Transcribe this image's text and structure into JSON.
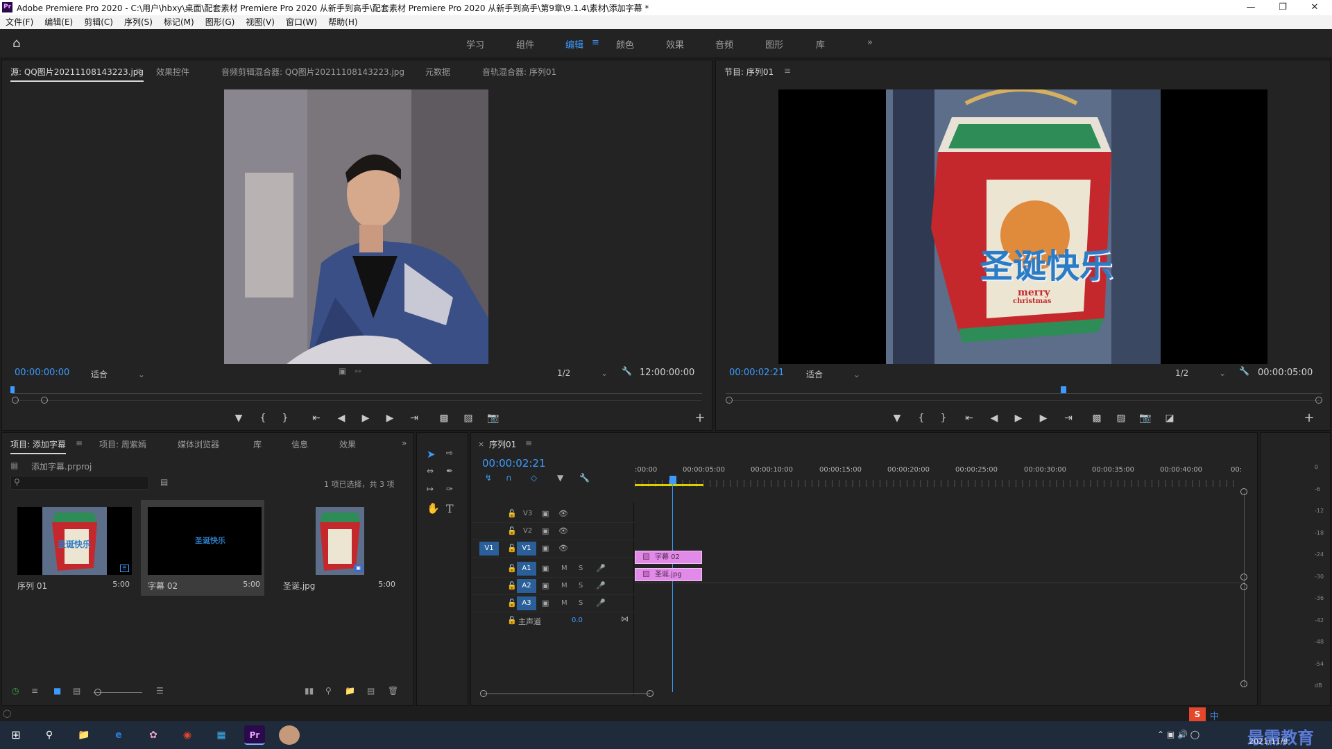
{
  "window": {
    "title": "Adobe Premiere Pro 2020 - C:\\用户\\hbxy\\桌面\\配套素材 Premiere Pro 2020 从新手到高手\\配套素材 Premiere Pro 2020 从新手到高手\\第9章\\9.1.4\\素材\\添加字幕 *",
    "logo": "Pr",
    "minimize": "—",
    "restore": "❐",
    "close": "✕"
  },
  "menu": [
    "文件(F)",
    "编辑(E)",
    "剪辑(C)",
    "序列(S)",
    "标记(M)",
    "图形(G)",
    "视图(V)",
    "窗口(W)",
    "帮助(H)"
  ],
  "workspaces": {
    "tabs": [
      "学习",
      "组件",
      "编辑",
      "颜色",
      "效果",
      "音频",
      "图形",
      "库"
    ],
    "active": "编辑",
    "more": "»"
  },
  "source_panel": {
    "tabs": [
      "源: QQ图片20211108143223.jpg",
      "效果控件",
      "音频剪辑混合器: QQ图片20211108143223.jpg",
      "元数据",
      "音轨混合器: 序列01"
    ],
    "timecode": "00:00:00:00",
    "fit": "适合",
    "resolution": "1/2",
    "duration": "12:00:00:00"
  },
  "program_panel": {
    "tab": "节目: 序列01",
    "timecode": "00:00:02:21",
    "fit": "适合",
    "resolution": "1/2",
    "duration": "00:00:05:00",
    "caption": "圣诞快乐",
    "box_text_1": "merry",
    "box_text_2": "christmas"
  },
  "project_panel": {
    "tabs": [
      "项目: 添加字幕",
      "项目: 周紫嫣",
      "媒体浏览器",
      "库",
      "信息",
      "效果"
    ],
    "file": "添加字幕.prproj",
    "selection_info": "1 项已选择，共 3 项",
    "search_placeholder": "",
    "items": [
      {
        "name": "序列 01",
        "duration": "5:00"
      },
      {
        "name": "字幕 02",
        "duration": "5:00",
        "preview_text": "圣诞快乐"
      },
      {
        "name": "圣诞.jpg",
        "duration": "5:00"
      }
    ]
  },
  "timeline": {
    "tab": "序列01",
    "timecode": "00:00:02:21",
    "ruler": [
      ":00:00",
      "00:00:05:00",
      "00:00:10:00",
      "00:00:15:00",
      "00:00:20:00",
      "00:00:25:00",
      "00:00:30:00",
      "00:00:35:00",
      "00:00:40:00",
      "00:"
    ],
    "video_tracks": [
      "V3",
      "V2",
      "V1"
    ],
    "audio_tracks": [
      "A1",
      "A2",
      "A3"
    ],
    "source_patch": "V1",
    "mute_label": "M",
    "solo_label": "S",
    "master_label": "主声道",
    "master_value": "0.0",
    "clips": {
      "v2": "字幕 02",
      "v1": "圣诞.jpg"
    }
  },
  "audio_meter": {
    "scale": [
      "0",
      "-6",
      "-12",
      "-18",
      "-24",
      "-30",
      "-36",
      "-42",
      "-48",
      "-54",
      "dB"
    ]
  },
  "taskbar": {
    "date": "2021/11/8",
    "watermark": "最需教育",
    "ime": "中"
  }
}
